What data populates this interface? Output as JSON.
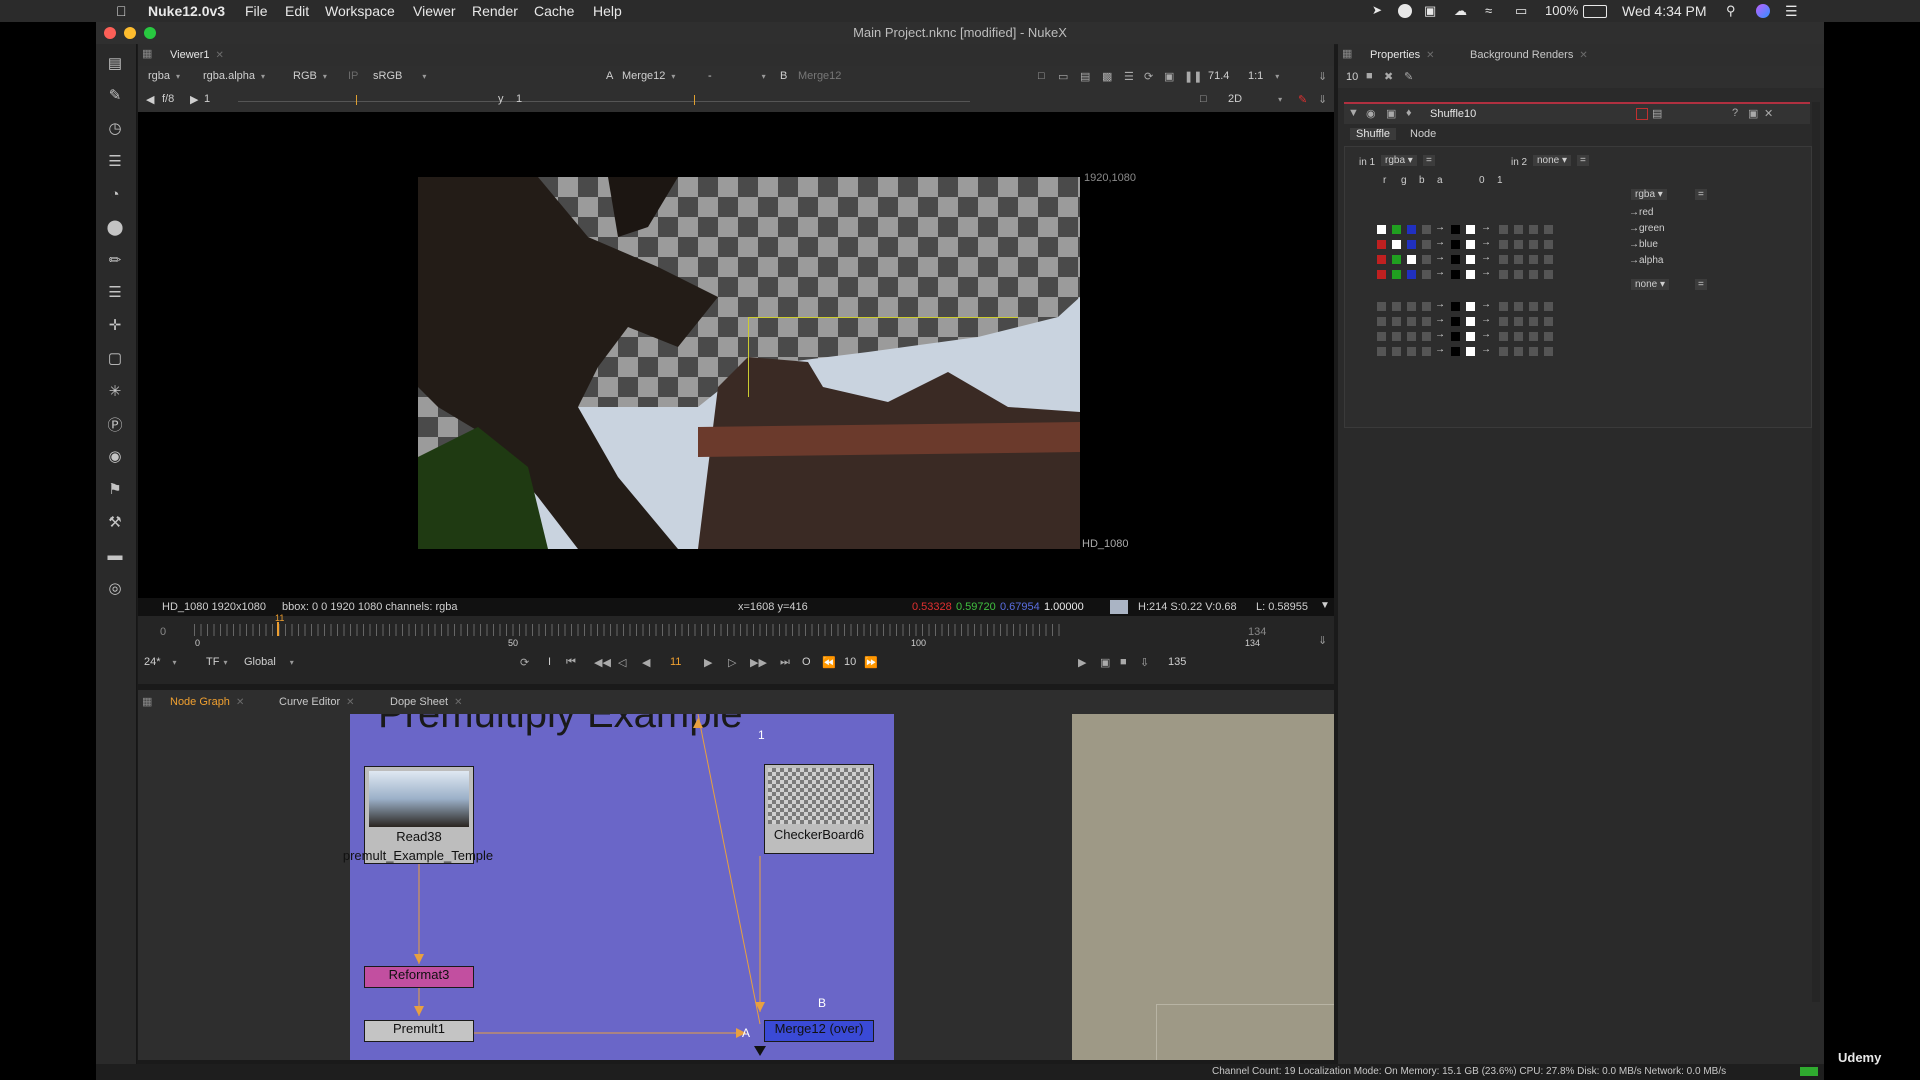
{
  "menubar": {
    "app_name": "Nuke12.0v3",
    "menus": [
      "File",
      "Edit",
      "Workspace",
      "Viewer",
      "Render",
      "Cache",
      "Help"
    ],
    "battery": "100%",
    "clock": "Wed 4:34 PM"
  },
  "window": {
    "title": "Main Project.nknc [modified] - NukeX"
  },
  "viewer": {
    "tab_label": "Viewer1",
    "channels": "rgba",
    "alpha_channel": "rgba.alpha",
    "display": "RGB",
    "ip_label": "IP",
    "lut": "sRGB",
    "a_label": "A",
    "a_input": "Merge12",
    "mid_dash": "-",
    "b_label": "B",
    "b_input": "Merge12",
    "zoom": "71.4",
    "ratio": "1:1",
    "fstop": "f/8",
    "gain": "1",
    "gamma_label": "y",
    "gamma": "1",
    "view_mode": "2D",
    "format_corner": "1920,1080",
    "format_name": "HD_1080",
    "info": {
      "format": "HD_1080 1920x1080",
      "bbox": "bbox: 0 0 1920 1080 channels: rgba",
      "coords": "x=1608 y=416",
      "r": "0.53328",
      "g": "0.59720",
      "b": "0.67954",
      "a": "1.00000",
      "hsv": "H:214 S:0.22 V:0.68",
      "luma": "L: 0.58955"
    },
    "colors": {
      "r": "#e03030",
      "g": "#40c040",
      "b": "#5a6ee0"
    }
  },
  "timeline": {
    "start": "0",
    "end": "134",
    "marks": [
      "0",
      "50",
      "100",
      "134"
    ],
    "current_frame": "11",
    "fps": "24*",
    "tf": "TF",
    "scope": "Global",
    "step": "10",
    "frame_out": "135",
    "in_label": "I",
    "out_label": "O"
  },
  "bottom_tabs": [
    "Node Graph",
    "Curve Editor",
    "Dope Sheet"
  ],
  "properties": {
    "tabs": [
      "Properties",
      "Background Renders"
    ],
    "panel_count": "10",
    "node_name": "Shuffle10",
    "subtabs": [
      "Shuffle",
      "Node"
    ],
    "in1_label": "in 1",
    "in1_value": "rgba",
    "in2_label": "in 2",
    "in2_value": "none",
    "col_headers_left": [
      "r",
      "g",
      "b",
      "a"
    ],
    "col_headers_mid": [
      "0",
      "1"
    ],
    "out1_value": "rgba",
    "out2_value": "none",
    "outputs": [
      "red",
      "green",
      "blue",
      "alpha"
    ]
  },
  "nodegraph": {
    "backdrop_title": "Premultiply Example",
    "nodes": {
      "read": "Read38",
      "read_file": "premult_Example_Temple",
      "checker": "CheckerBoard6",
      "reformat": "Reformat3",
      "premult": "Premult1",
      "merge": "Merge12 (over)"
    },
    "pipe_labels": {
      "one": "1",
      "a": "A",
      "b": "B"
    }
  },
  "status": {
    "text": "Channel Count: 19  Localization Mode: On  Memory: 15.1 GB (23.6%)  CPU: 27.8%  Disk: 0.0 MB/s  Network: 0.0 MB/s"
  },
  "watermark": "Udemy"
}
